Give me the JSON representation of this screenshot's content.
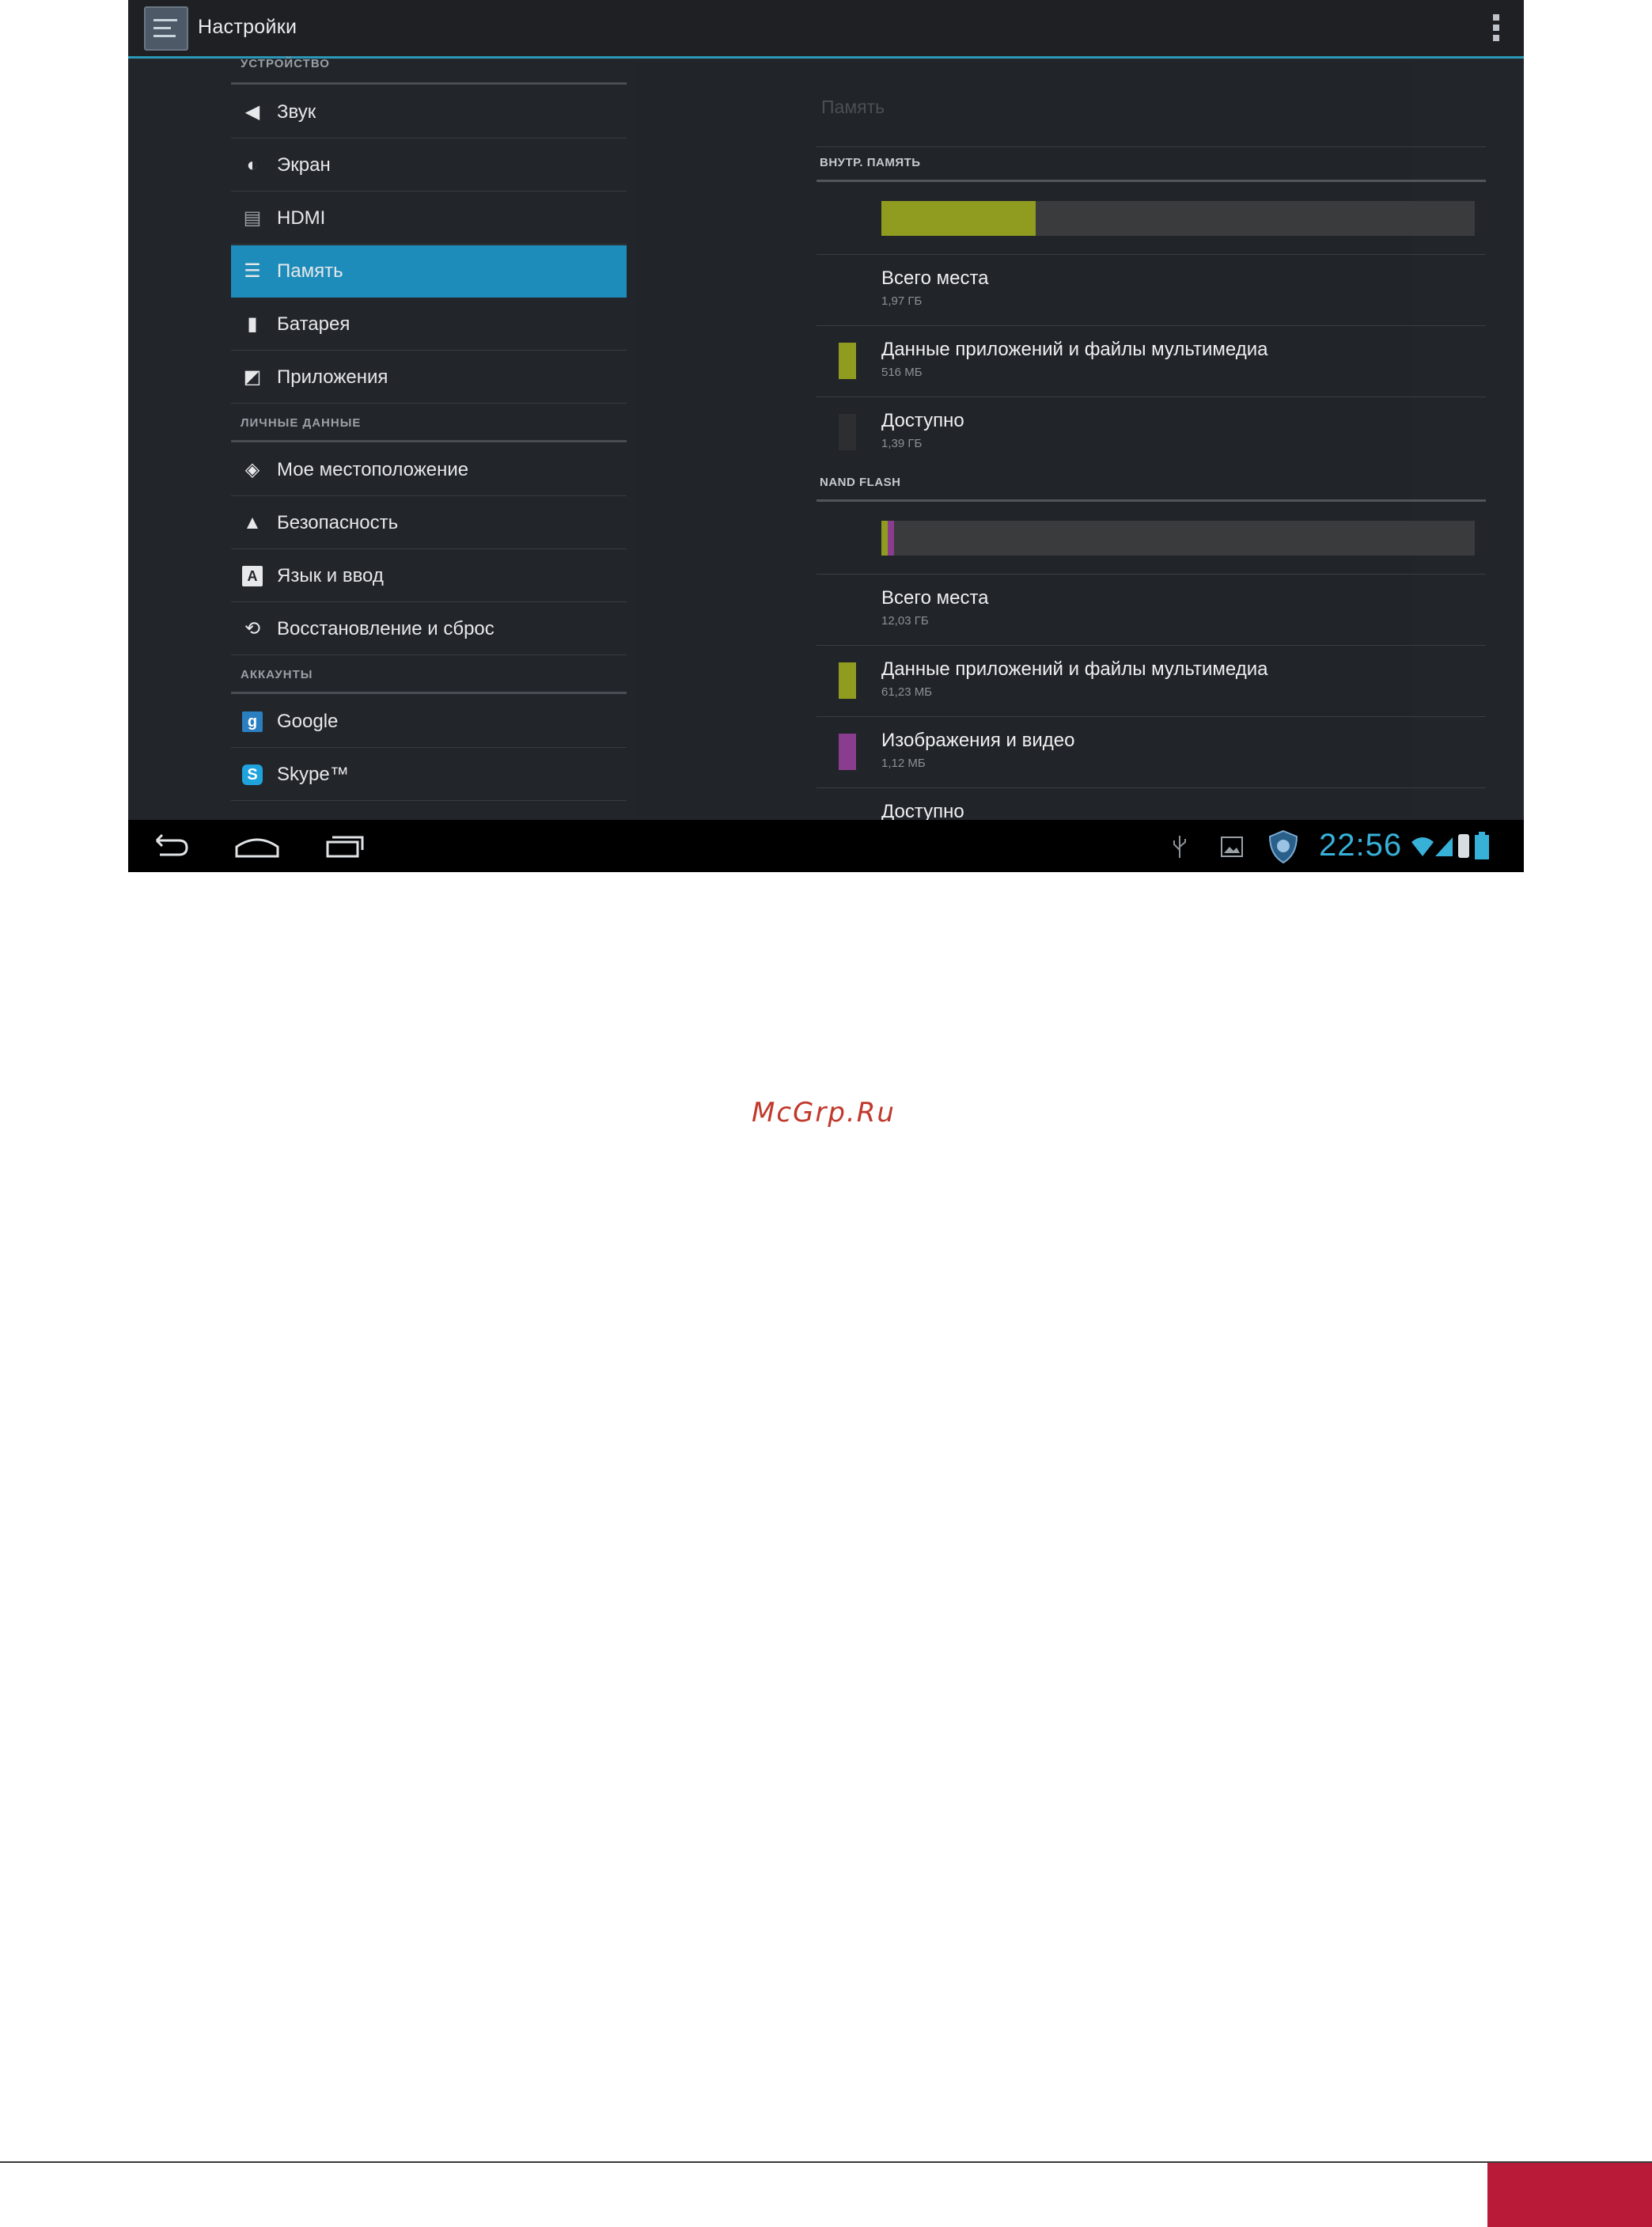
{
  "actionbar": {
    "title": "Настройки",
    "app_icon": "settings-icon",
    "overflow_icon": "overflow-menu-icon"
  },
  "sidebar": {
    "sections": [
      {
        "header": "УСТРОЙСТВО",
        "items": [
          {
            "label": "Звук",
            "icon": "volume-icon",
            "glyph": "🔈"
          },
          {
            "label": "Экран",
            "icon": "display-icon",
            "glyph": "◐"
          },
          {
            "label": "HDMI",
            "icon": "hdmi-icon",
            "glyph": "▤"
          },
          {
            "label": "Память",
            "icon": "storage-icon",
            "glyph": "≡",
            "selected": true
          },
          {
            "label": "Батарея",
            "icon": "battery-icon",
            "glyph": "▮"
          },
          {
            "label": "Приложения",
            "icon": "apps-icon",
            "glyph": "◩"
          }
        ]
      },
      {
        "header": "ЛИЧНЫЕ ДАННЫЕ",
        "items": [
          {
            "label": "Мое местоположение",
            "icon": "location-icon",
            "glyph": "◈"
          },
          {
            "label": "Безопасность",
            "icon": "lock-icon",
            "glyph": "🔒"
          },
          {
            "label": "Язык и ввод",
            "icon": "keyboard-icon",
            "glyph": "A"
          },
          {
            "label": "Восстановление и сброс",
            "icon": "restore-icon",
            "glyph": "⟲"
          }
        ]
      },
      {
        "header": "АККАУНТЫ",
        "items": [
          {
            "label": "Google",
            "icon": "google-icon",
            "glyph": "g"
          },
          {
            "label": "Skype™",
            "icon": "skype-icon",
            "glyph": "S"
          }
        ]
      }
    ]
  },
  "content": {
    "title": "Память",
    "internal": {
      "header": "ВНУТР. ПАМЯТЬ",
      "usage_fraction": 0.26,
      "total_label": "Всего места",
      "total_value": "1,97 ГБ",
      "apps_label": "Данные приложений и файлы мультимедиа",
      "apps_value": "516 МБ",
      "free_label": "Доступно",
      "free_value": "1,39 ГБ"
    },
    "nand": {
      "header": "NAND FLASH",
      "usage_fraction_apps": 0.01,
      "usage_fraction_images": 0.01,
      "total_label": "Всего места",
      "total_value": "12,03 ГБ",
      "apps_label": "Данные приложений и файлы мультимедиа",
      "apps_value": "61,23 МБ",
      "images_label": "Изображения и видео",
      "images_value": "1,12 МБ",
      "next_label": "Доступно"
    }
  },
  "statusbar": {
    "time": "22:56",
    "icons": [
      "back-icon",
      "home-icon",
      "recent-apps-icon",
      "usb-icon",
      "gallery-icon",
      "shield-icon",
      "wifi-icon",
      "signal-icon",
      "battery-icon"
    ]
  },
  "colors": {
    "accent": "#2b98b8",
    "selected": "#1e8cba",
    "apps_data": "#8f9c1f",
    "images": "#8a3d8f",
    "clock": "#37b1d8",
    "brand_red": "#b91a37"
  },
  "page": {
    "watermark": "McGrp.Ru"
  }
}
